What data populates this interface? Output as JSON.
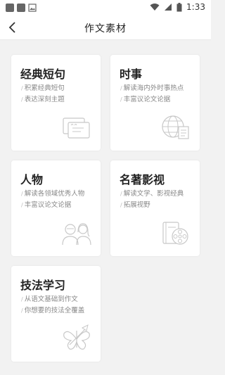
{
  "status": {
    "time": "1:33"
  },
  "header": {
    "title": "作文素材"
  },
  "cards": [
    {
      "title": "经典短句",
      "lines": [
        "积累经典短句",
        "表达深刻主题"
      ],
      "icon": "cards-icon"
    },
    {
      "title": "时事",
      "lines": [
        "解读海内外时事热点",
        "丰富议论文论据"
      ],
      "icon": "globe-icon"
    },
    {
      "title": "人物",
      "lines": [
        "解读各领域优秀人物",
        "丰富议论文论据"
      ],
      "icon": "people-icon"
    },
    {
      "title": "名著影视",
      "lines": [
        "解读文学、影视经典",
        "拓展视野"
      ],
      "icon": "book-film-icon"
    },
    {
      "title": "技法学习",
      "lines": [
        "从语文基础到作文",
        "你想要的技法全覆盖"
      ],
      "icon": "butterfly-pen-icon"
    }
  ]
}
